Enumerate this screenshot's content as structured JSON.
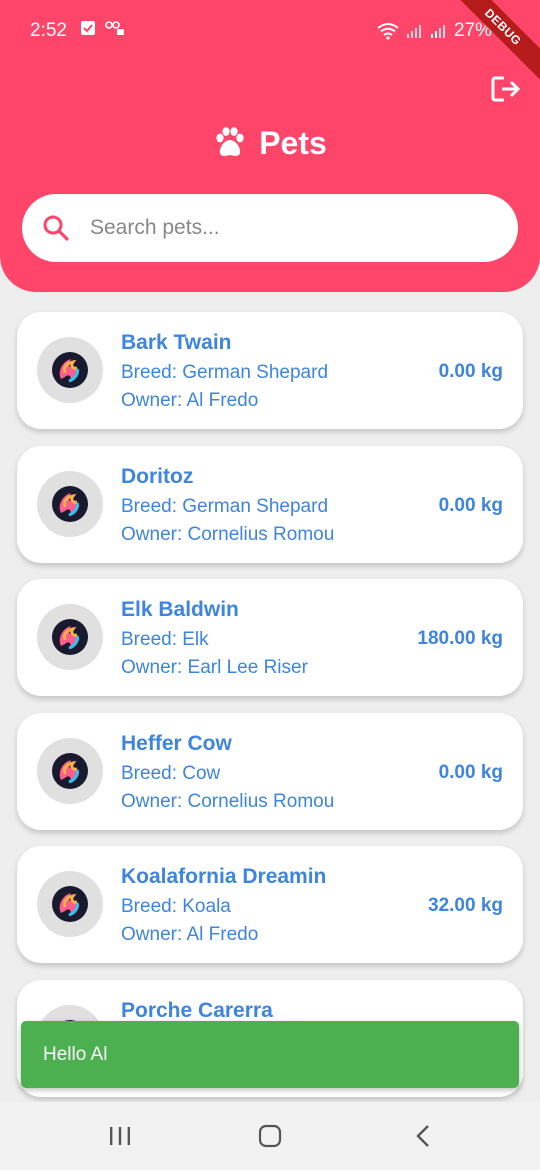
{
  "status_bar": {
    "time": "2:52",
    "battery": "27%",
    "debug_label": "DEBUG"
  },
  "header": {
    "title": "Pets",
    "logout_icon": "logout-icon",
    "paw_icon": "paw-icon"
  },
  "search": {
    "placeholder": "Search pets...",
    "icon": "search-icon"
  },
  "pets": [
    {
      "name": "Bark Twain",
      "breed": "Breed: German Shepard",
      "owner": "Owner: Al Fredo",
      "weight": "0.00 kg"
    },
    {
      "name": "Doritoz",
      "breed": "Breed: German Shepard",
      "owner": "Owner: Cornelius Romou",
      "weight": "0.00 kg"
    },
    {
      "name": "Elk Baldwin",
      "breed": "Breed: Elk",
      "owner": "Owner: Earl Lee Riser",
      "weight": "180.00 kg"
    },
    {
      "name": "Heffer Cow",
      "breed": "Breed: Cow",
      "owner": "Owner: Cornelius Romou",
      "weight": "0.00 kg"
    },
    {
      "name": "Koalafornia Dreamin",
      "breed": "Breed: Koala",
      "owner": "Owner: Al Fredo",
      "weight": "32.00 kg"
    },
    {
      "name": "Porche Carerra",
      "breed": "",
      "owner": "",
      "weight": ""
    }
  ],
  "snackbar": {
    "message": "Hello Al"
  },
  "colors": {
    "header": "#ff4569",
    "accent_text": "#3d85e0",
    "snackbar": "#4caf50"
  }
}
